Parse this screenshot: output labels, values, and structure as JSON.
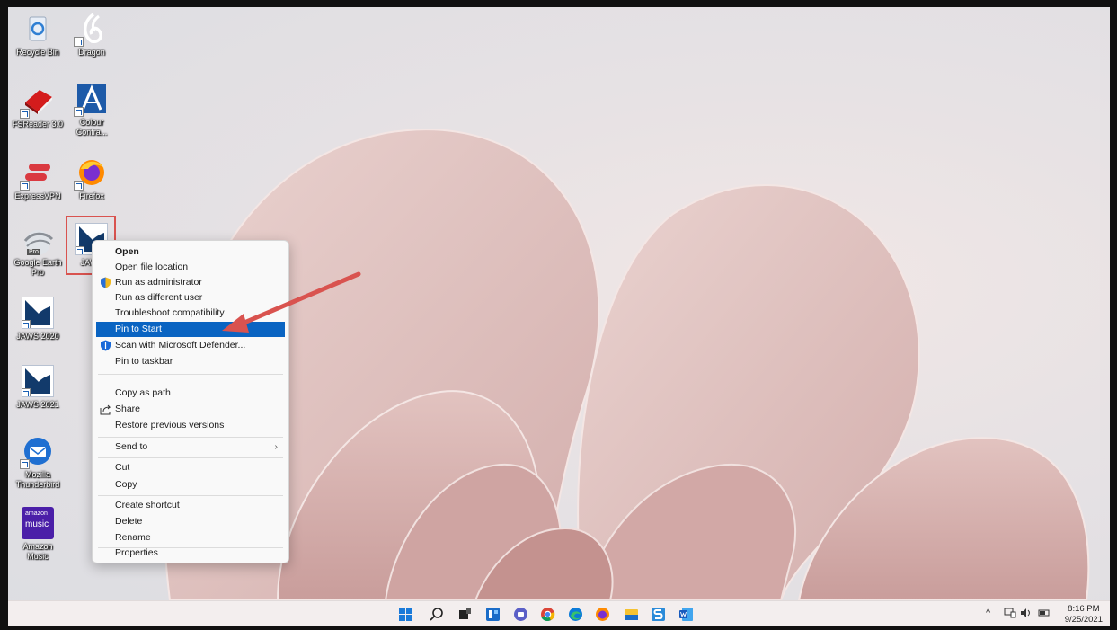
{
  "desktop": {
    "icons": [
      {
        "label": "Recycle Bin",
        "icon": "recycle-bin-icon"
      },
      {
        "label": "Dragon",
        "icon": "dragon-icon"
      },
      {
        "label": "FSReader 3.0",
        "icon": "book-icon"
      },
      {
        "label": "Colour Contra...",
        "icon": "colour-contrast-icon"
      },
      {
        "label": "ExpressVPN",
        "icon": "expressvpn-icon"
      },
      {
        "label": "Firefox",
        "icon": "firefox-icon"
      },
      {
        "label": "Google Earth Pro",
        "icon": "google-earth-icon"
      },
      {
        "label": "JAWS",
        "icon": "jaws-icon"
      },
      {
        "label": "JAWS 2020",
        "icon": "jaws-icon"
      },
      {
        "label": "JAWS 2021",
        "icon": "jaws-icon"
      },
      {
        "label": "Mozilla Thunderbird",
        "icon": "thunderbird-icon"
      },
      {
        "label": "Amazon Music",
        "icon": "amazon-music-icon"
      }
    ],
    "pro_badge": "Pro",
    "amazon_tile_text": [
      "amazon",
      "music"
    ]
  },
  "context_menu": {
    "items": [
      {
        "label": "Open",
        "bold": true
      },
      {
        "label": "Open file location"
      },
      {
        "label": "Run as administrator",
        "icon": "uac-shield-icon"
      },
      {
        "label": "Run as different user"
      },
      {
        "label": "Troubleshoot compatibility"
      },
      {
        "label": "Pin to Start",
        "highlighted": true
      },
      {
        "label": "Scan with Microsoft Defender...",
        "icon": "defender-shield-icon"
      },
      {
        "label": "Pin to taskbar"
      },
      {
        "label": "Copy as path"
      },
      {
        "label": "Share",
        "icon": "share-icon"
      },
      {
        "label": "Restore previous versions"
      },
      {
        "label": "Send to",
        "submenu": true
      },
      {
        "label": "Cut"
      },
      {
        "label": "Copy"
      },
      {
        "label": "Create shortcut"
      },
      {
        "label": "Delete"
      },
      {
        "label": "Rename"
      },
      {
        "label": "Properties"
      }
    ],
    "submenu_glyph": "›"
  },
  "taskbar": {
    "apps": [
      "windows-start-icon",
      "search-icon",
      "task-view-icon",
      "widgets-icon",
      "teams-chat-icon",
      "chrome-icon",
      "edge-icon",
      "firefox-icon",
      "file-explorer-icon",
      "s-app-icon",
      "word-icon"
    ],
    "tray_chevron": "^",
    "clock_time": "8:16 PM",
    "clock_date": "9/25/2021"
  },
  "colors": {
    "menu_highlight": "#0a64c2",
    "annotation_red": "#d9534f",
    "taskbar_bg": "#f3eeee"
  }
}
